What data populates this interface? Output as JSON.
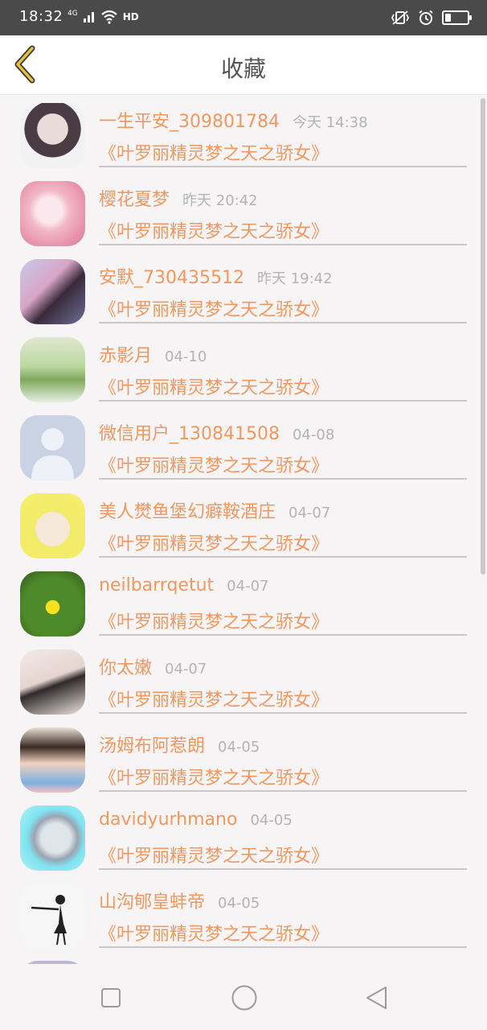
{
  "status_bar": {
    "time": "18:32",
    "network": "4G",
    "hd": "HD",
    "battery_level": 0.25
  },
  "header": {
    "title": "收藏",
    "back_icon": "chevron-left-icon"
  },
  "colors": {
    "accent": "#f09860",
    "time_gray": "#b3b3b3",
    "back_icon": "#e8c23a"
  },
  "favorites": [
    {
      "name": "一生平安_309801784",
      "time": "今天 14:38",
      "book": "《叶罗丽精灵梦之天之骄女》"
    },
    {
      "name": "樱花夏梦",
      "time": "昨天 20:42",
      "book": "《叶罗丽精灵梦之天之骄女》"
    },
    {
      "name": "安默_730435512",
      "time": "昨天 19:42",
      "book": "《叶罗丽精灵梦之天之骄女》"
    },
    {
      "name": "赤影月",
      "time": "04-10",
      "book": "《叶罗丽精灵梦之天之骄女》"
    },
    {
      "name": "微信用户_130841508",
      "time": "04-08",
      "book": "《叶罗丽精灵梦之天之骄女》"
    },
    {
      "name": "美人燓鱼堡幻癖鞍酒庄",
      "time": "04-07",
      "book": "《叶罗丽精灵梦之天之骄女》"
    },
    {
      "name": "neilbarrqetut",
      "time": "04-07",
      "book": "《叶罗丽精灵梦之天之骄女》"
    },
    {
      "name": "你太嫩",
      "time": "04-07",
      "book": "《叶罗丽精灵梦之天之骄女》"
    },
    {
      "name": "汤姆布阿惹朗",
      "time": "04-05",
      "book": "《叶罗丽精灵梦之天之骄女》"
    },
    {
      "name": "davidyurhmano",
      "time": "04-05",
      "book": "《叶罗丽精灵梦之天之骄女》"
    },
    {
      "name": "山沟郇皇蚌帝",
      "time": "04-05",
      "book": "《叶罗丽精灵梦之天之骄女》"
    }
  ],
  "nav_bar": {
    "recents_icon": "square-icon",
    "home_icon": "circle-icon",
    "back_icon": "triangle-back-icon"
  }
}
